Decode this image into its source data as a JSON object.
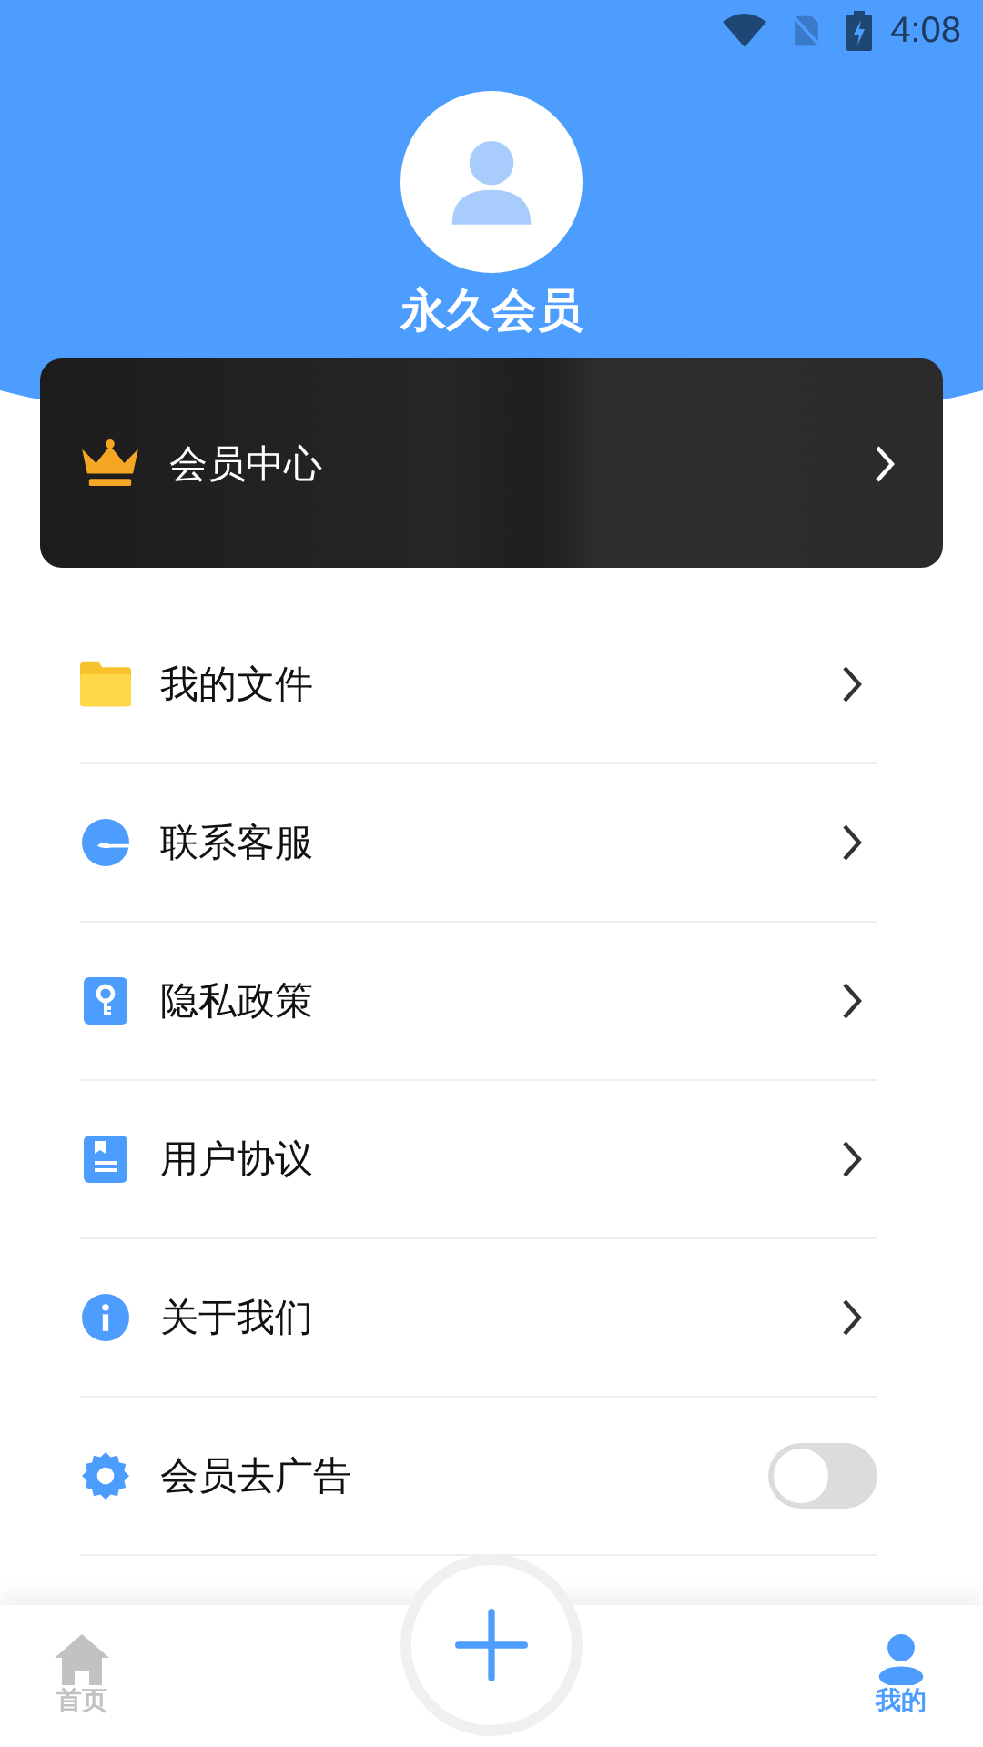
{
  "status_bar": {
    "time": "4:08"
  },
  "profile": {
    "name": "永久会员"
  },
  "vip_card": {
    "label": "会员中心"
  },
  "menu": [
    {
      "kind": "link",
      "label": "我的文件"
    },
    {
      "kind": "link",
      "label": "联系客服"
    },
    {
      "kind": "link",
      "label": "隐私政策"
    },
    {
      "kind": "link",
      "label": "用户协议"
    },
    {
      "kind": "link",
      "label": "关于我们"
    },
    {
      "kind": "toggle",
      "label": "会员去广告",
      "on": false
    }
  ],
  "bottom_nav": [
    {
      "label": "首页",
      "selected": false
    },
    {
      "label": "我的",
      "selected": true
    }
  ]
}
